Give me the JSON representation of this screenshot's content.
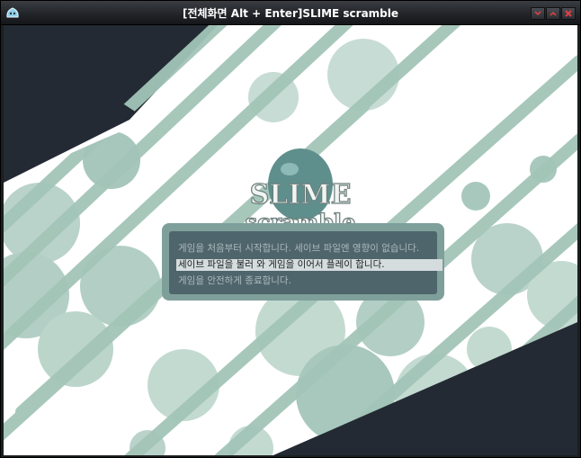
{
  "window": {
    "title": "[전체화면 Alt + Enter]SLIME scramble",
    "icons": {
      "app": "slime-app-icon",
      "minimize": "minimize-icon",
      "maximize": "maximize-icon",
      "close": "close-icon"
    },
    "colors": {
      "titlebar": "#26292d",
      "close": "#d43a3a"
    }
  },
  "logo": {
    "line1": "SLIME",
    "line2": "scramble"
  },
  "menu": {
    "items": [
      {
        "label": "게임을 처음부터 시작합니다. 세이브 파일엔 영향이 없습니다.",
        "selected": false
      },
      {
        "label": "세이브 파일을 불러 와 게임을 이어서 플레이 합니다.",
        "selected": true
      },
      {
        "label": "게임을 안전하게 종료합니다.",
        "selected": false
      }
    ]
  },
  "colors": {
    "background": "#232a33",
    "bubble": "#b8d2c8",
    "stripe": "#9fc2b4",
    "menu_frame": "#7f9f9b",
    "menu_inner": "#4f656c",
    "selected": "#d5dcdd"
  }
}
